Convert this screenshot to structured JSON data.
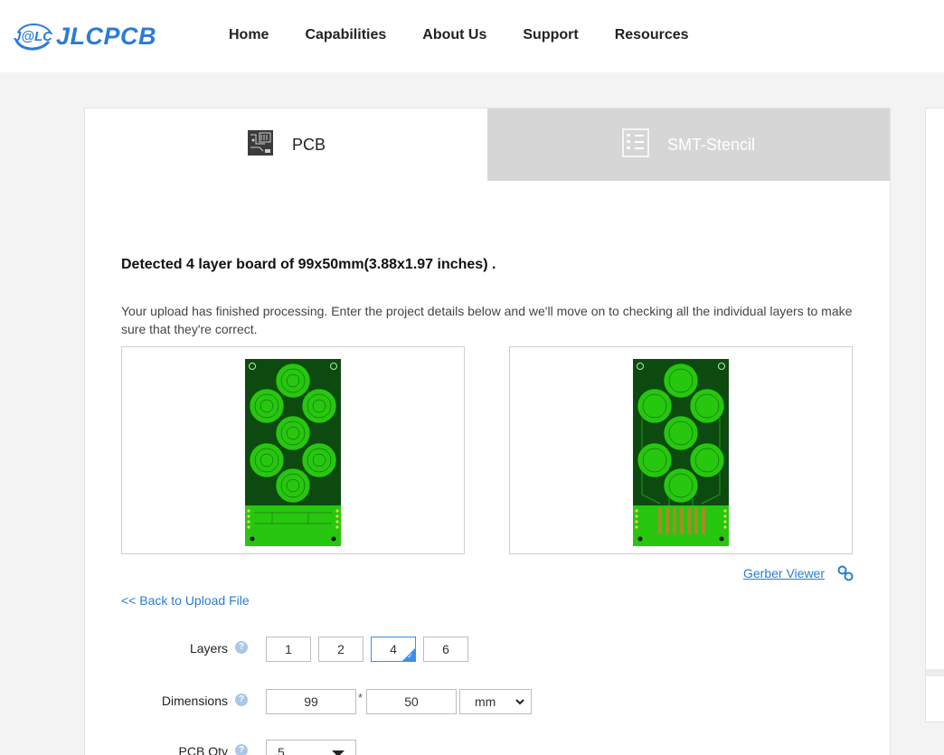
{
  "header": {
    "logo_mark": "J@LC",
    "logo_text": "JLCPCB",
    "brand_color": "#2c7bd6",
    "nav": [
      "Home",
      "Capabilities",
      "About Us",
      "Support",
      "Resources"
    ]
  },
  "tabs": {
    "pcb": {
      "label": "PCB",
      "icon": "pcb-board-icon",
      "active": true
    },
    "smt": {
      "label": "SMT-Stencil",
      "icon": "stencil-icon",
      "active": false
    }
  },
  "content": {
    "detected": "Detected 4 layer board of 99x50mm(3.88x1.97 inches) .",
    "description": "Your upload has finished processing. Enter the project details below and we'll move on to checking all the individual layers to make sure that they're correct.",
    "previews": [
      "pcb-top-preview",
      "pcb-bottom-preview"
    ],
    "gerber_viewer": "Gerber Viewer",
    "back_link": "<< Back to Upload File"
  },
  "form": {
    "layers": {
      "label": "Layers",
      "options": [
        "1",
        "2",
        "4",
        "6"
      ],
      "selected": "4"
    },
    "dimensions": {
      "label": "Dimensions",
      "width": "99",
      "separator": "*",
      "height": "50",
      "unit": "mm"
    },
    "qty": {
      "label": "PCB Qty",
      "value": "5"
    },
    "help_glyph": "?"
  },
  "colors": {
    "link": "#2a7ccf",
    "selected_border": "#3a8ee6",
    "pcb_green_dark": "#0c4a10",
    "pcb_green_bright": "#27c60f"
  }
}
